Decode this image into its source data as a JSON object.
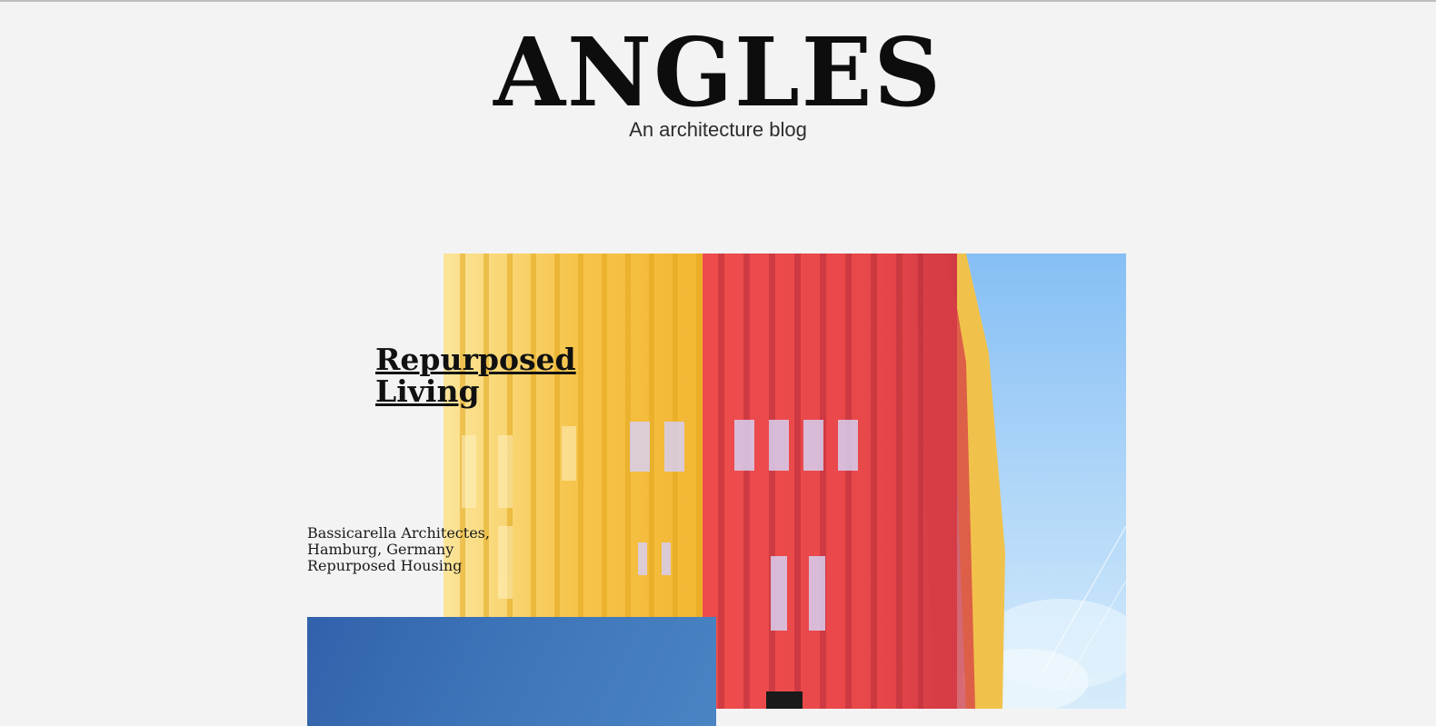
{
  "site": {
    "title": "ANGLES",
    "tagline": "An architecture blog"
  },
  "featured_post": {
    "title": "Repurposed Living",
    "meta": {
      "architect": "Bassicarella Architectes,",
      "location": "Hamburg, Germany",
      "category": "Repurposed Housing"
    },
    "image_icon": "colorful-facade-photo"
  },
  "next_post": {
    "image_icon": "blue-sky-photo"
  },
  "colors": {
    "background": "#f3f3f3",
    "text": "#111111",
    "facade_yellow": "#f5c13f",
    "facade_red": "#e8474a",
    "sky_blue": "#9fd0f7"
  }
}
